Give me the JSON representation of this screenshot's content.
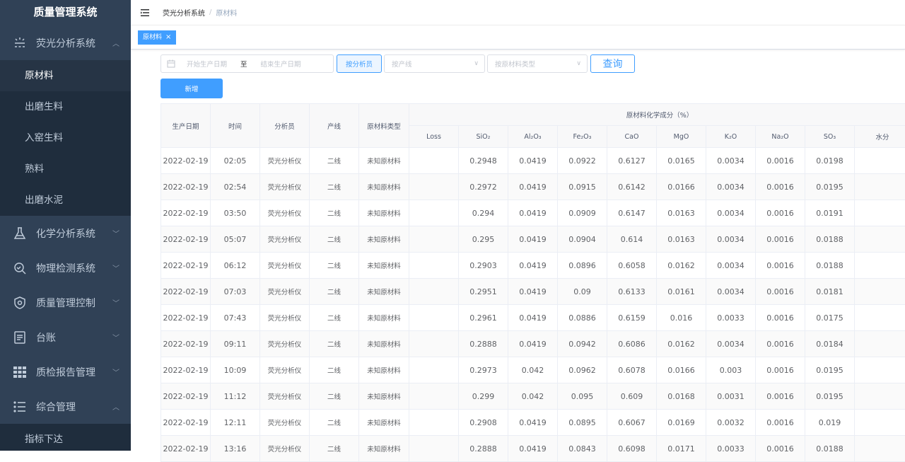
{
  "sidebar": {
    "brand": "质量管理系统",
    "groups": [
      {
        "label": "荧光分析系统",
        "icon": "fluorescence-icon",
        "expanded": true
      },
      {
        "label": "化学分析系统",
        "icon": "flask-icon",
        "expanded": false
      },
      {
        "label": "物理检测系统",
        "icon": "magnifier-icon",
        "expanded": false
      },
      {
        "label": "质量管理控制",
        "icon": "shield-icon",
        "expanded": false
      },
      {
        "label": "台账",
        "icon": "ledger-icon",
        "expanded": false
      },
      {
        "label": "质检报告管理",
        "icon": "grid-icon",
        "expanded": false
      },
      {
        "label": "综合管理",
        "icon": "list-icon",
        "expanded": true
      }
    ],
    "fluorescence_items": [
      "原材料",
      "出磨生料",
      "入窑生料",
      "熟料",
      "出磨水泥"
    ],
    "general_items": [
      "指标下达"
    ],
    "active_item": "原材料"
  },
  "navbar": {
    "breadcrumb": [
      "荧光分析系统",
      "原材料"
    ],
    "separator": "/"
  },
  "tags": [
    {
      "label": "原材料",
      "close": "×"
    }
  ],
  "filters": {
    "start_date_placeholder": "开始生产日期",
    "range_separator": "至",
    "end_date_placeholder": "结束生产日期",
    "analyst_button": "按分析员",
    "line_placeholder": "按产线",
    "material_type_placeholder": "按原材料类型",
    "query_button": "查询"
  },
  "add_button": "新增",
  "table": {
    "fixed_headers": [
      "生产日期",
      "时间",
      "分析员",
      "产线",
      "原材料类型"
    ],
    "group_header": "原材料化学成分（%）",
    "composition_headers": [
      "Loss",
      "SiO₂",
      "Al₂O₃",
      "Fe₂O₃",
      "CaO",
      "MgO",
      "K₂O",
      "Na₂O",
      "SO₃",
      "水分"
    ],
    "rows": [
      [
        "2022-02-19",
        "02:05",
        "荧光分析仪",
        "二线",
        "未知原材料",
        "",
        "0.2948",
        "0.0419",
        "0.0922",
        "0.6127",
        "0.0165",
        "0.0034",
        "0.0016",
        "0.0198",
        ""
      ],
      [
        "2022-02-19",
        "02:54",
        "荧光分析仪",
        "二线",
        "未知原材料",
        "",
        "0.2972",
        "0.0419",
        "0.0915",
        "0.6142",
        "0.0166",
        "0.0034",
        "0.0016",
        "0.0195",
        ""
      ],
      [
        "2022-02-19",
        "03:50",
        "荧光分析仪",
        "二线",
        "未知原材料",
        "",
        "0.294",
        "0.0419",
        "0.0909",
        "0.6147",
        "0.0163",
        "0.0034",
        "0.0016",
        "0.0191",
        ""
      ],
      [
        "2022-02-19",
        "05:07",
        "荧光分析仪",
        "二线",
        "未知原材料",
        "",
        "0.295",
        "0.0419",
        "0.0904",
        "0.614",
        "0.0163",
        "0.0034",
        "0.0016",
        "0.0188",
        ""
      ],
      [
        "2022-02-19",
        "06:12",
        "荧光分析仪",
        "二线",
        "未知原材料",
        "",
        "0.2903",
        "0.0419",
        "0.0896",
        "0.6058",
        "0.0162",
        "0.0034",
        "0.0016",
        "0.0188",
        ""
      ],
      [
        "2022-02-19",
        "07:03",
        "荧光分析仪",
        "二线",
        "未知原材料",
        "",
        "0.2951",
        "0.0419",
        "0.09",
        "0.6133",
        "0.0161",
        "0.0034",
        "0.0016",
        "0.0181",
        ""
      ],
      [
        "2022-02-19",
        "07:43",
        "荧光分析仪",
        "二线",
        "未知原材料",
        "",
        "0.2961",
        "0.0419",
        "0.0886",
        "0.6159",
        "0.016",
        "0.0033",
        "0.0016",
        "0.0175",
        ""
      ],
      [
        "2022-02-19",
        "09:11",
        "荧光分析仪",
        "二线",
        "未知原材料",
        "",
        "0.2888",
        "0.0419",
        "0.0942",
        "0.6086",
        "0.0162",
        "0.0034",
        "0.0016",
        "0.0184",
        ""
      ],
      [
        "2022-02-19",
        "10:09",
        "荧光分析仪",
        "二线",
        "未知原材料",
        "",
        "0.2973",
        "0.042",
        "0.0962",
        "0.6078",
        "0.0166",
        "0.003",
        "0.0016",
        "0.0195",
        ""
      ],
      [
        "2022-02-19",
        "11:12",
        "荧光分析仪",
        "二线",
        "未知原材料",
        "",
        "0.299",
        "0.042",
        "0.095",
        "0.609",
        "0.0168",
        "0.0031",
        "0.0016",
        "0.0195",
        ""
      ],
      [
        "2022-02-19",
        "12:11",
        "荧光分析仪",
        "二线",
        "未知原材料",
        "",
        "0.2908",
        "0.0419",
        "0.0895",
        "0.6067",
        "0.0169",
        "0.0032",
        "0.0016",
        "0.019",
        ""
      ],
      [
        "2022-02-19",
        "13:16",
        "荧光分析仪",
        "二线",
        "未知原材料",
        "",
        "0.2888",
        "0.0419",
        "0.0843",
        "0.6098",
        "0.0171",
        "0.0033",
        "0.0016",
        "0.0188",
        ""
      ]
    ]
  },
  "colors": {
    "sidebar_bg": "#304156",
    "submenu_bg": "#1f2d3d",
    "accent": "#409eff"
  }
}
